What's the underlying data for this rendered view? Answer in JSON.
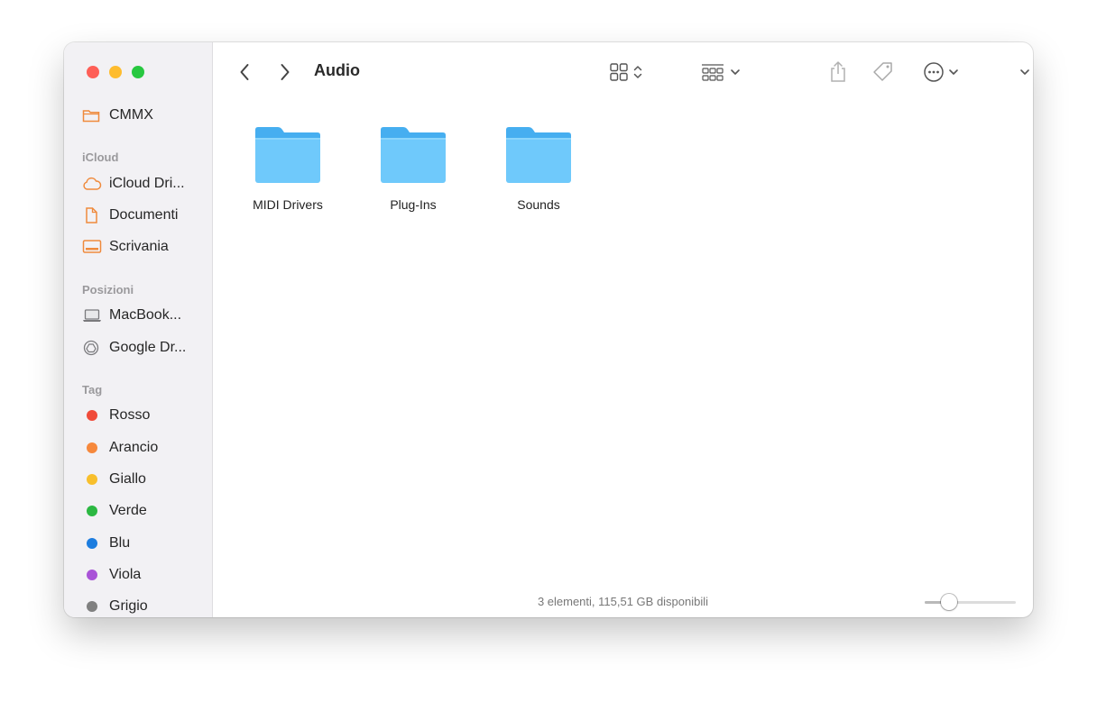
{
  "window": {
    "title": "Audio",
    "status": "3 elementi, 115,51 GB disponibili",
    "zoom_level": 0.27
  },
  "sidebar": {
    "top_items": [
      {
        "label": "CMMX",
        "icon": "folder-icon"
      }
    ],
    "sections": [
      {
        "header": "iCloud",
        "items": [
          {
            "label": "iCloud Dri...",
            "icon": "cloud-icon"
          },
          {
            "label": "Documenti",
            "icon": "document-icon"
          },
          {
            "label": "Scrivania",
            "icon": "desktop-icon"
          }
        ]
      },
      {
        "header": "Posizioni",
        "items": [
          {
            "label": "MacBook...",
            "icon": "laptop-icon"
          },
          {
            "label": "Google Dr...",
            "icon": "google-drive-icon"
          }
        ]
      },
      {
        "header": "Tag",
        "items": [
          {
            "label": "Rosso",
            "color": "#f04b3a"
          },
          {
            "label": "Arancio",
            "color": "#f6883c"
          },
          {
            "label": "Giallo",
            "color": "#f8bf2c"
          },
          {
            "label": "Verde",
            "color": "#2cb842"
          },
          {
            "label": "Blu",
            "color": "#1d7ddf"
          },
          {
            "label": "Viola",
            "color": "#a953d7"
          },
          {
            "label": "Grigio",
            "color": "#808080"
          }
        ]
      }
    ]
  },
  "folders": [
    {
      "name": "MIDI Drivers"
    },
    {
      "name": "Plug-Ins"
    },
    {
      "name": "Sounds"
    }
  ],
  "colors": {
    "accent_orange": "#ef8a3c",
    "folder_blue": "#6fc9fb",
    "folder_tab": "#46aef0"
  }
}
